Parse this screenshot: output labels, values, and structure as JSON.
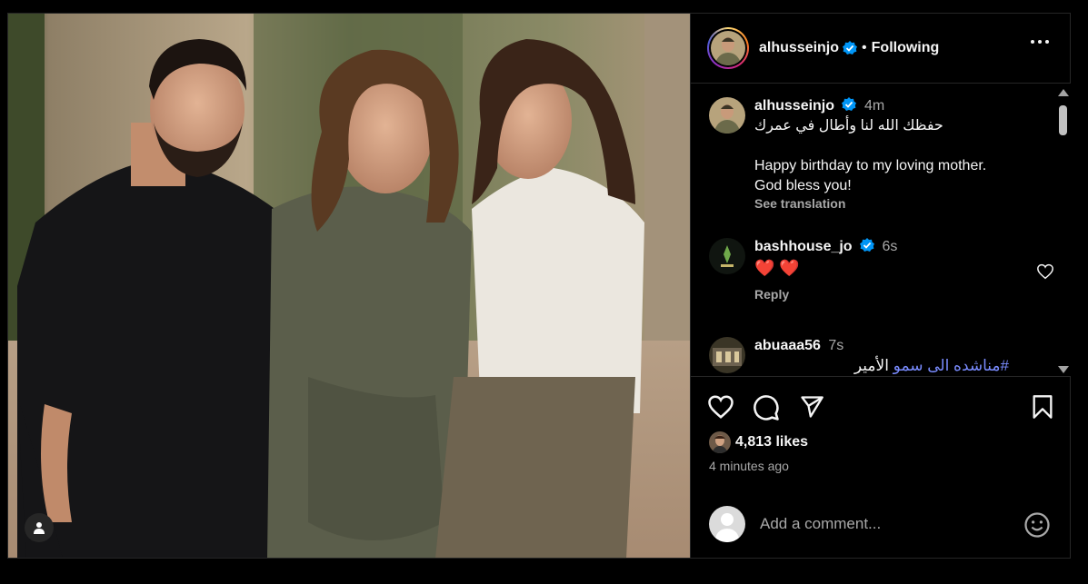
{
  "post": {
    "author": "alhusseinjo",
    "follow_state": "Following",
    "separator": "•"
  },
  "caption": {
    "username": "alhusseinjo",
    "time": "4m",
    "text_ar": "حفظك الله لنا وأطال في عمرك",
    "text_en": "Happy birthday to my loving mother.\nGod bless you!",
    "see_translation": "See translation"
  },
  "comments": [
    {
      "username": "bashhouse_jo",
      "time": "6s",
      "text": "❤️ ❤️",
      "reply": "Reply",
      "verified": true
    },
    {
      "username": "abuaaa56",
      "time": "7s",
      "text_hashtag": "#مناشده الى سمو",
      "text_tail": "الأمير",
      "verified": false
    }
  ],
  "engagement": {
    "likes": "4,813 likes",
    "time_ago": "4 minutes ago"
  },
  "comment_box": {
    "placeholder": "Add a comment..."
  },
  "icons": {
    "verified": "verified-badge-icon",
    "more": "more-options-icon",
    "like": "heart-icon",
    "comment": "comment-icon",
    "share": "share-icon",
    "save": "bookmark-icon",
    "emoji": "emoji-icon",
    "tag": "user-tag-icon"
  },
  "colors": {
    "background": "#000000",
    "border": "#262626",
    "secondary_text": "#a8a8a8",
    "verified": "#0095f6",
    "heart": "#ed4956",
    "hashtag": "#7a8cff"
  }
}
